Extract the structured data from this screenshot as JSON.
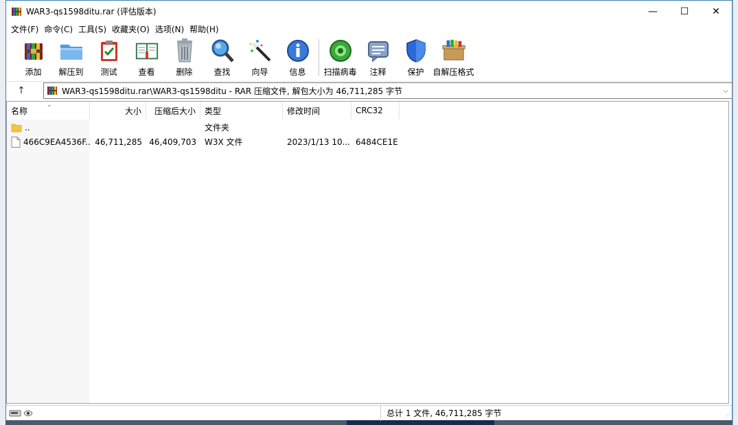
{
  "window": {
    "title": "WAR3-qs1598ditu.rar (评估版本)",
    "controls": {
      "minimize": "—",
      "maximize": "☐",
      "close": "✕"
    }
  },
  "menu": [
    "文件(F)",
    "命令(C)",
    "工具(S)",
    "收藏夹(O)",
    "选项(N)",
    "帮助(H)"
  ],
  "toolbar": [
    {
      "label": "添加",
      "icon": "add-archive-icon"
    },
    {
      "label": "解压到",
      "icon": "extract-folder-icon"
    },
    {
      "label": "测试",
      "icon": "test-clipboard-icon"
    },
    {
      "label": "查看",
      "icon": "view-book-icon"
    },
    {
      "label": "删除",
      "icon": "trash-icon"
    },
    {
      "label": "查找",
      "icon": "magnifier-icon"
    },
    {
      "label": "向导",
      "icon": "wand-icon"
    },
    {
      "label": "信息",
      "icon": "info-icon"
    },
    {
      "label": "扫描病毒",
      "icon": "virus-scan-icon"
    },
    {
      "label": "注释",
      "icon": "comment-icon"
    },
    {
      "label": "保护",
      "icon": "shield-icon"
    },
    {
      "label": "自解压格式",
      "icon": "sfx-box-icon"
    }
  ],
  "address": {
    "up": "↑",
    "path": "WAR3-qs1598ditu.rar\\WAR3-qs1598ditu - RAR 压缩文件, 解包大小为 46,711,285 字节",
    "dropdown": "⌵"
  },
  "columns": {
    "name": "名称",
    "size": "大小",
    "packed": "压缩后大小",
    "type": "类型",
    "modified": "修改时间",
    "crc": "CRC32"
  },
  "rows": [
    {
      "name": "..",
      "size": "",
      "packed": "",
      "type": "文件夹",
      "modified": "",
      "crc": ""
    },
    {
      "name": "466C9EA4536F...",
      "size": "46,711,285",
      "packed": "46,409,703",
      "type": "W3X 文件",
      "modified": "2023/1/13 10...",
      "crc": "6484CE1E"
    }
  ],
  "status": {
    "summary": "总计 1 文件, 46,711,285 字节"
  },
  "colors": {
    "border": "#3c7fb1",
    "folder": "#f4c542"
  }
}
